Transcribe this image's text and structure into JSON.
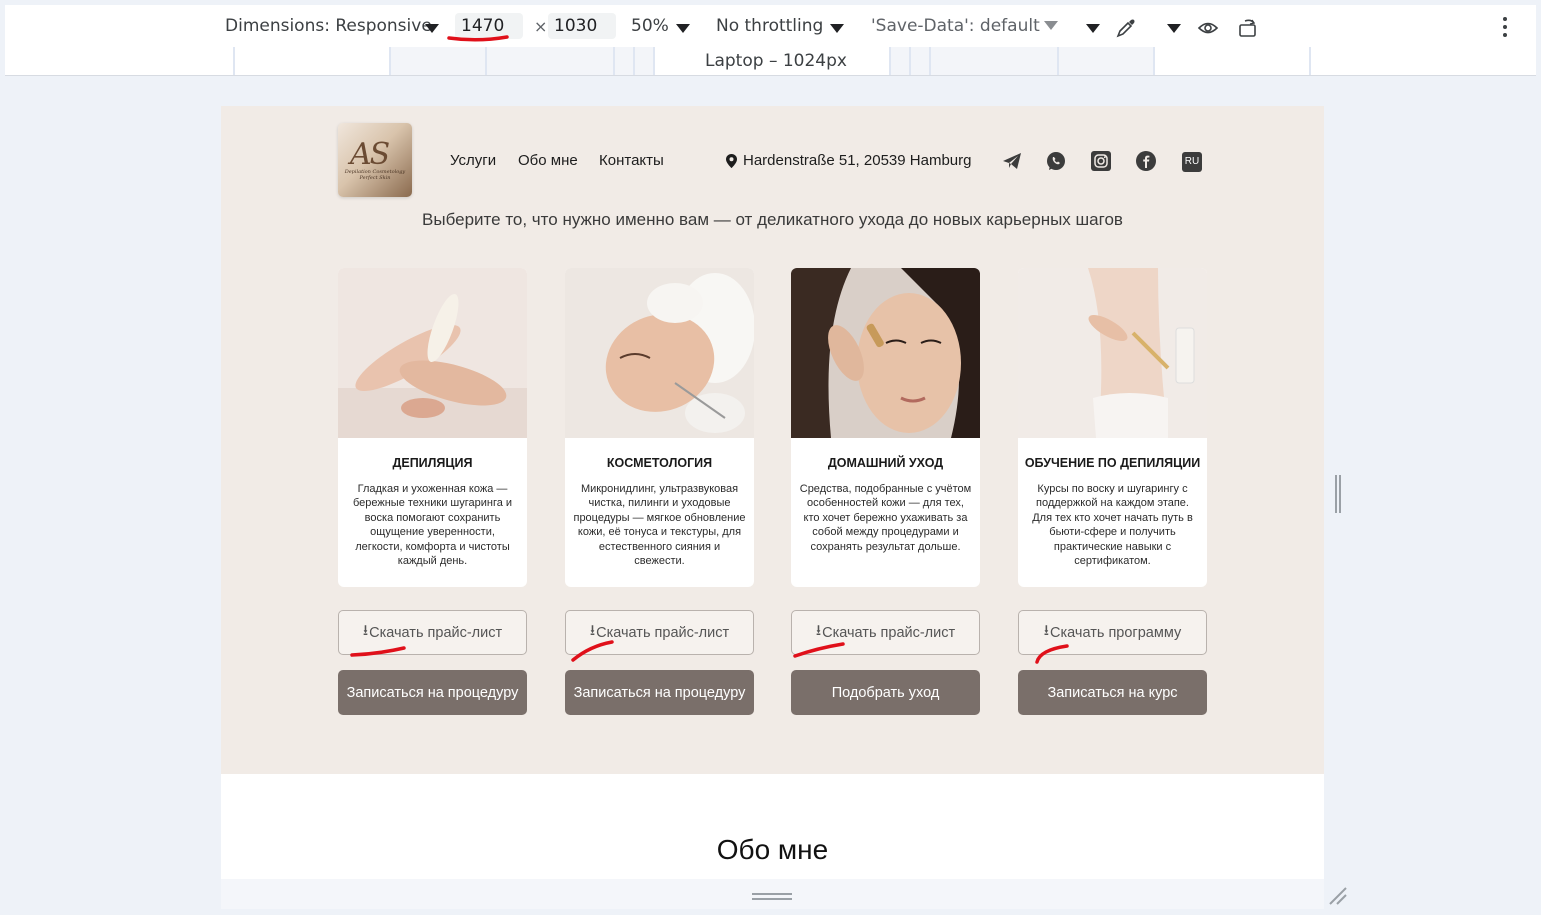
{
  "devtools": {
    "dimensions_label": "Dimensions: Responsive",
    "width_value": "1470",
    "times": "×",
    "height_value": "1030",
    "zoom": "50%",
    "throttling": "No throttling",
    "save_data": "'Save-Data': default",
    "media_query_label": "Laptop – 1024px",
    "icons": [
      "chevron-down-icon",
      "eyedropper-icon",
      "eye-icon",
      "rotate-icon",
      "kebab-menu-icon"
    ]
  },
  "site": {
    "logo_text": "AS",
    "logo_sub": "Depilation Cosmetology Perfect Skin",
    "nav": [
      "Услуги",
      "Обо мне",
      "Контакты"
    ],
    "address": "Hardenstraße 51, 20539 Hamburg",
    "social_icons": [
      "telegram-icon",
      "whatsapp-icon",
      "instagram-icon",
      "facebook-icon"
    ],
    "lang": "RU",
    "subtitle": "Выберите то, что нужно именно вам — от деликатного ухода до новых карьерных шагов",
    "cards": [
      {
        "title": "ДЕПИЛЯЦИЯ",
        "desc": "Гладкая и ухоженная кожа — бережные техники шугаринга и воска помогают сохранить ощущение уверенности, легкости, комфорта и чистоты каждый день.",
        "download": "Скачать прайс-лист",
        "action": "Записаться на процедуру"
      },
      {
        "title": "КОСМЕТОЛОГИЯ",
        "desc": "Микронидлинг, ультразвуковая чистка, пилинги и уходовые процедуры — мягкое обновление кожи, её тонуса и текстуры, для естественного сияния и свежести.",
        "download": "Скачать прайс-лист",
        "action": "Записаться на процедуру"
      },
      {
        "title": "ДОМАШНИЙ УХОД",
        "desc": "Средства, подобранные с учётом особенностей кожи — для тех, кто хочет бережно ухаживать за собой между процедурами и сохранять результат дольше.",
        "download": "Скачать прайс-лист",
        "action": "Подобрать уход"
      },
      {
        "title": "ОБУЧЕНИЕ ПО ДЕПИЛЯЦИИ",
        "desc": "Курсы по воску и шугарингу с поддержкой на каждом этапе. Для тех кто хочет начать путь в бьюти-сфере и получить практические навыки с сертификатом.",
        "download": "Скачать программу",
        "action": "Записаться на курс"
      }
    ],
    "about_title": "Обо мне"
  },
  "colors": {
    "hero_bg": "#f1ebe6",
    "button_fill": "#7a6f6a",
    "annotation": "#e0101a"
  }
}
